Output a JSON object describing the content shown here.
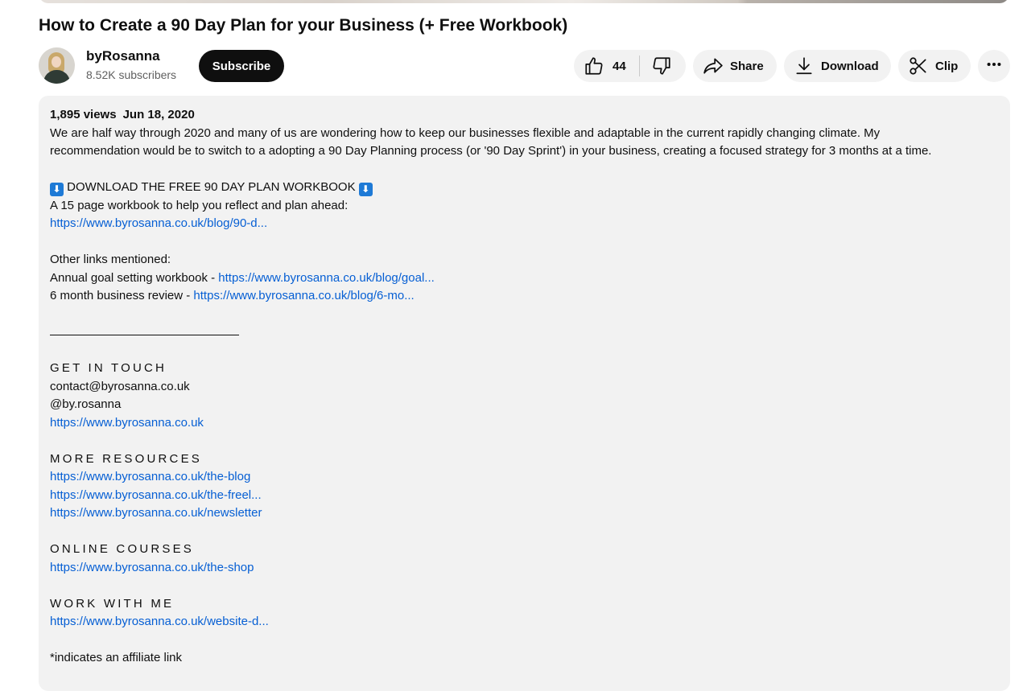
{
  "video": {
    "title": "How to Create a 90 Day Plan for your Business (+ Free Workbook)"
  },
  "channel": {
    "name": "byRosanna",
    "subscribers": "8.52K subscribers",
    "subscribe_label": "Subscribe"
  },
  "actions": {
    "like_count": "44",
    "share_label": "Share",
    "download_label": "Download",
    "clip_label": "Clip"
  },
  "icons": {
    "like": "thumbs-up-icon",
    "dislike": "thumbs-down-icon",
    "share": "share-arrow-icon",
    "download": "download-icon",
    "clip": "scissors-icon",
    "more": "more-horizontal-icon"
  },
  "colors": {
    "link": "#065fd4",
    "subscribe_bg": "#0f0f0f",
    "pill_bg": "#f2f2f2",
    "desc_bg": "#f2f2f2"
  },
  "description": {
    "views": "1,895 views",
    "date": "Jun 18, 2020",
    "intro_1": "We are half way through 2020 and many of us are wondering how to keep our businesses flexible and adaptable in the current rapidly changing climate. My",
    "intro_2": "recommendation would be to switch to a adopting a 90 Day Planning process (or '90 Day Sprint') in your business, creating a focused strategy for 3 months at a time.",
    "download_heading": "DOWNLOAD THE FREE 90 DAY PLAN WORKBOOK",
    "download_emoji": "⬇",
    "workbook_text": "A 15 page workbook to help you reflect and plan ahead:",
    "workbook_link": "https://www.byrosanna.co.uk/blog/90-d...",
    "other_links_heading": "Other links mentioned:",
    "annual_label": "Annual goal setting workbook - ",
    "annual_link": "https://www.byrosanna.co.uk/blog/goal...",
    "review_label": "6 month business review - ",
    "review_link": "https://www.byrosanna.co.uk/blog/6-mo...",
    "get_in_touch_heading": "GET IN TOUCH",
    "email": "contact@byrosanna.co.uk",
    "handle": "@by.rosanna",
    "site_link": "https://www.byrosanna.co.uk",
    "more_resources_heading": "MORE RESOURCES",
    "blog_link": "https://www.byrosanna.co.uk/the-blog",
    "freel_link": "https://www.byrosanna.co.uk/the-freel...",
    "newsletter_link": "https://www.byrosanna.co.uk/newsletter",
    "courses_heading": "ONLINE COURSES",
    "shop_link": "https://www.byrosanna.co.uk/the-shop",
    "work_heading": "WORK WITH ME",
    "website_link": "https://www.byrosanna.co.uk/website-d...",
    "affiliate_note": "*indicates an affiliate link"
  }
}
